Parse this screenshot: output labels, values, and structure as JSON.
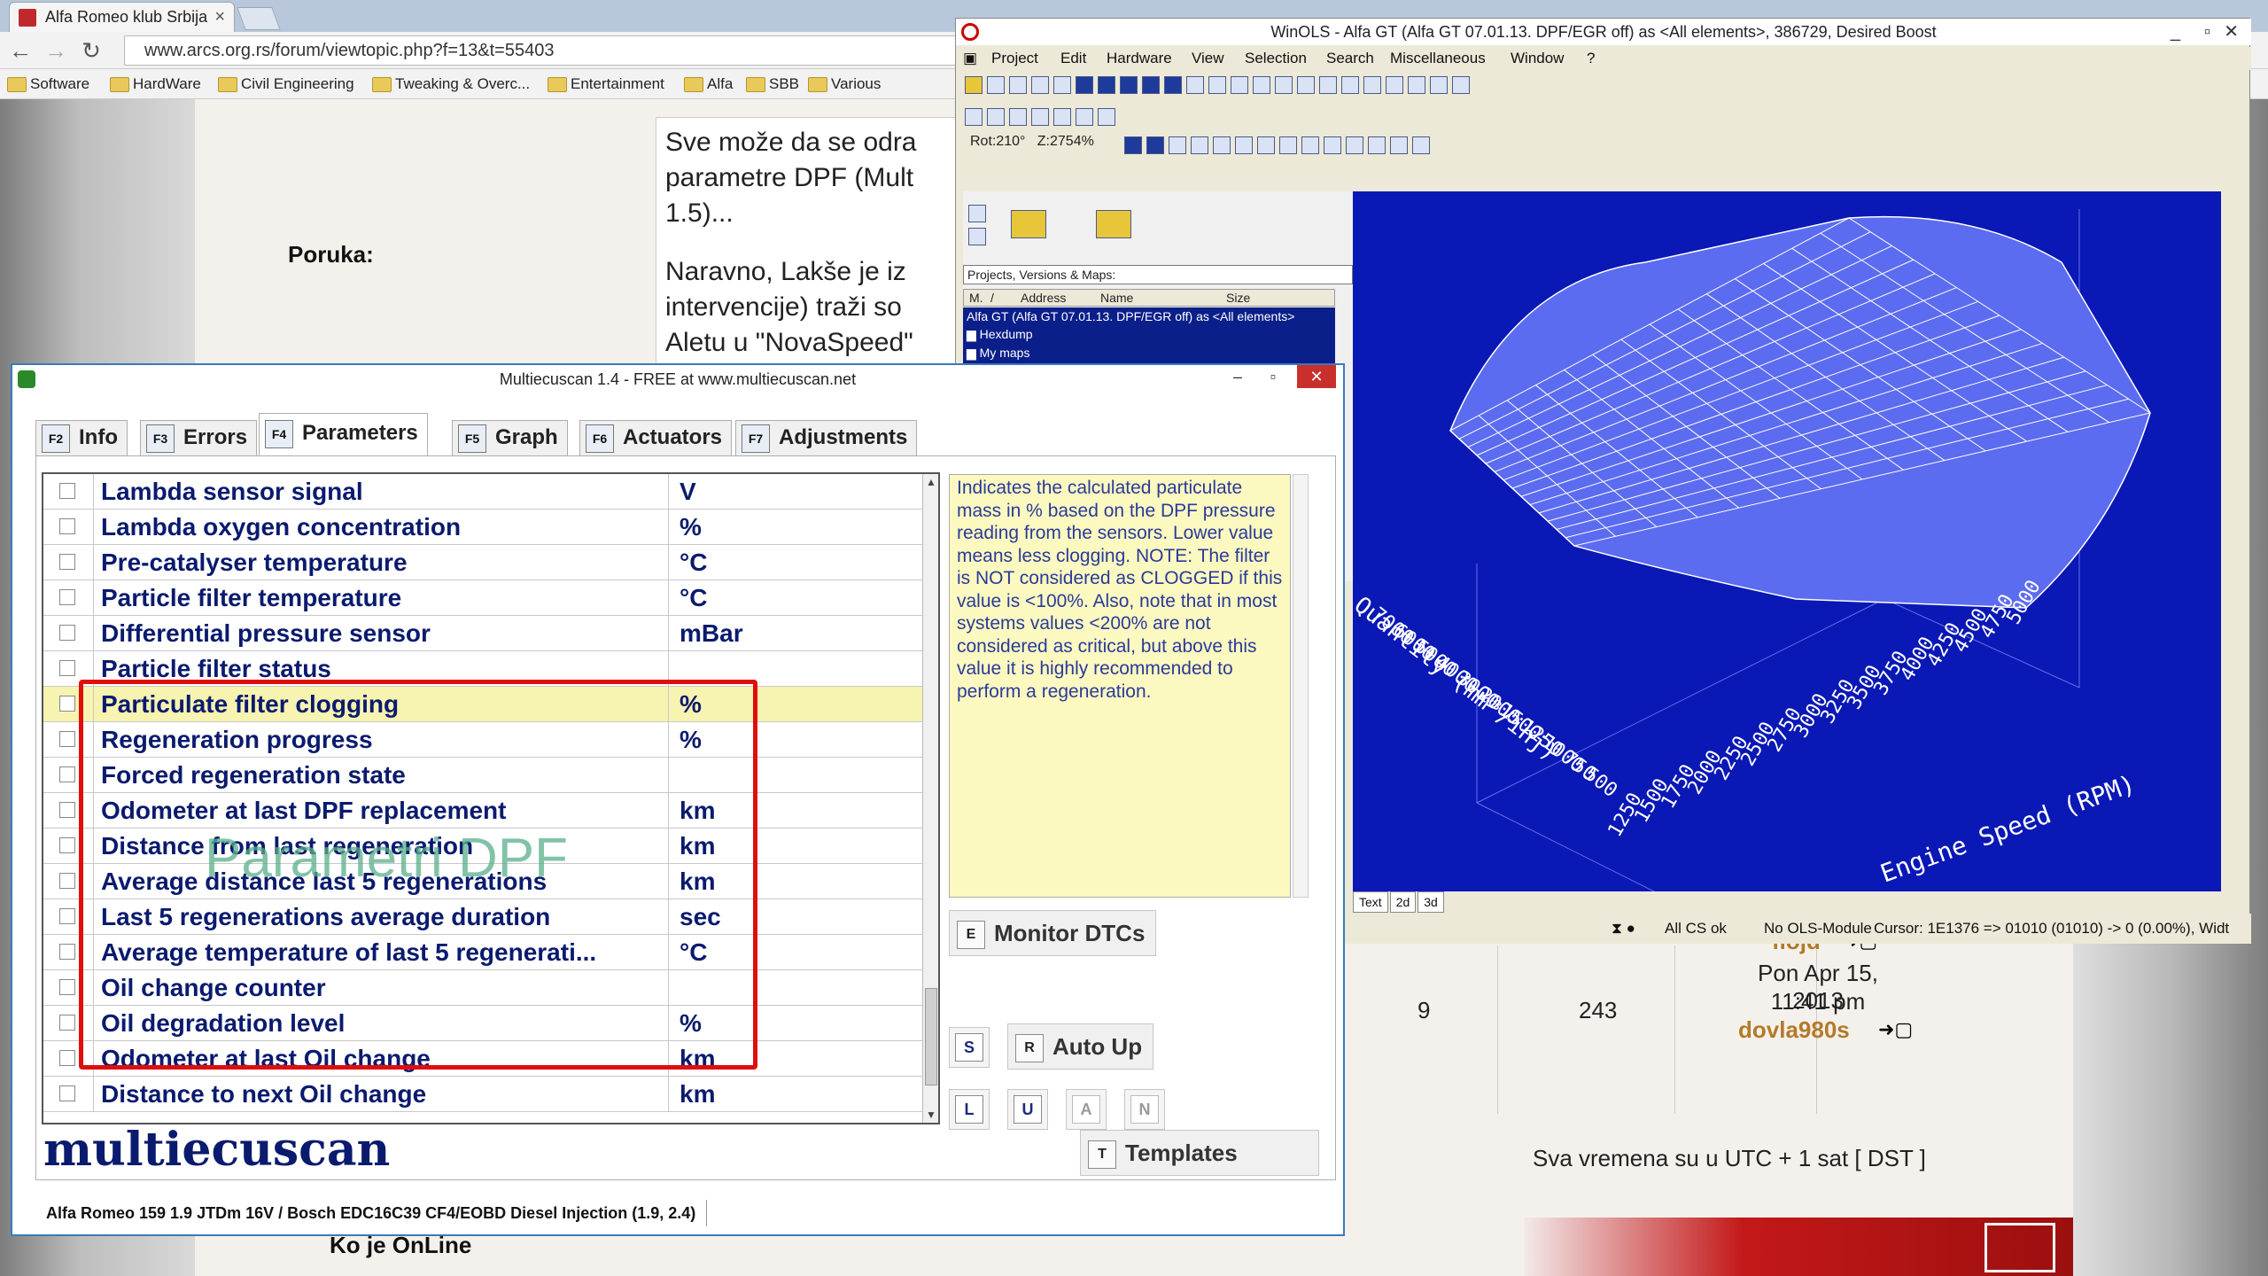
{
  "browser": {
    "tab_title": "Alfa Romeo klub Srbija",
    "url": "www.arcs.org.rs/forum/viewtopic.php?f=13&t=55403",
    "bookmarks": [
      "Software",
      "HardWare",
      "Civil Engineering",
      "Tweaking & Overc...",
      "Entertainment",
      "Alfa",
      "SBB",
      "Various"
    ]
  },
  "forum": {
    "message_label": "Poruka:",
    "message_lines": [
      "Sve može da se odra",
      "parametre DPF (Mult",
      "1.5)..."
    ],
    "message_lines2": [
      "Naravno, Lakše je iz",
      "intervencije) traži so",
      "Aletu u \"NovaSpeed\""
    ],
    "stats": {
      "col1": "9",
      "col2": "243",
      "date": "Pon Apr 15, 2013",
      "time": "11:41 pm",
      "user1": "flojd",
      "user2": "dovla980s"
    },
    "timezone_note": "Sva vremena su u UTC + 1 sat [ DST ]",
    "online_title": "Ko je OnLine"
  },
  "winols": {
    "title": "WinOLS - Alfa GT (Alfa GT 07.01.13. DPF/EGR off) as <All elements>, 386729, Desired Boost",
    "menu": [
      "Project",
      "Edit",
      "Hardware",
      "View",
      "Selection",
      "Search",
      "Miscellaneous",
      "Window",
      "?"
    ],
    "rotation": "Rot:210°",
    "zoom": "Z:2754%",
    "projects_label": "Projects, Versions & Maps:",
    "columns": [
      "M.",
      "/",
      "Address",
      "Name",
      "Size"
    ],
    "project_row": "Alfa GT (Alfa GT 07.01.13. DPF/EGR off) as <All elements>",
    "folders": [
      "Hexdump",
      "My maps"
    ],
    "axis_y_label": "Quantity (mm³/inj)",
    "axis_x_label": "Engine Speed (RPM)",
    "y_ticks": [
      "7000",
      "6000",
      "5000",
      "4000",
      "3000",
      "2000",
      "1500",
      "1250",
      "1000",
      "750",
      "500"
    ],
    "x_ticks": [
      "1250",
      "1500",
      "1750",
      "2000",
      "2250",
      "2500",
      "2750",
      "3000",
      "3250",
      "3500",
      "3750",
      "4000",
      "4250",
      "4500",
      "4750",
      "5000"
    ],
    "view_tabs": [
      "Text",
      "2d",
      "3d"
    ],
    "status": {
      "cs": "All CS ok",
      "module": "No OLS-Module",
      "cursor": "Cursor: 1E1376 => 01010 (01010) -> 0 (0.00%), Widt"
    }
  },
  "mes": {
    "title": "Multiecuscan 1.4 - FREE at www.multiecuscan.net",
    "tabs": [
      {
        "key": "F2",
        "label": "Info"
      },
      {
        "key": "F3",
        "label": "Errors"
      },
      {
        "key": "F4",
        "label": "Parameters"
      },
      {
        "key": "F5",
        "label": "Graph"
      },
      {
        "key": "F6",
        "label": "Actuators"
      },
      {
        "key": "F7",
        "label": "Adjustments"
      }
    ],
    "parameters": [
      {
        "name": "Lambda sensor signal",
        "unit": "V"
      },
      {
        "name": "Lambda oxygen concentration",
        "unit": "%"
      },
      {
        "name": "Pre-catalyser temperature",
        "unit": "°C"
      },
      {
        "name": "Particle filter temperature",
        "unit": "°C"
      },
      {
        "name": "Differential pressure sensor",
        "unit": "mBar"
      },
      {
        "name": "Particle filter status",
        "unit": ""
      },
      {
        "name": "Particulate filter clogging",
        "unit": "%"
      },
      {
        "name": "Regeneration progress",
        "unit": "%"
      },
      {
        "name": "Forced regeneration state",
        "unit": ""
      },
      {
        "name": "Odometer at last DPF replacement",
        "unit": "km"
      },
      {
        "name": "Distance from last regeneration",
        "unit": "km"
      },
      {
        "name": "Average distance last 5 regenerations",
        "unit": "km"
      },
      {
        "name": "Last 5 regenerations average duration",
        "unit": "sec"
      },
      {
        "name": "Average temperature of last 5 regenerati...",
        "unit": "°C"
      },
      {
        "name": "Oil change counter",
        "unit": ""
      },
      {
        "name": "Oil degradation level",
        "unit": "%"
      },
      {
        "name": "Odometer at last Oil change",
        "unit": "km"
      },
      {
        "name": "Distance to next Oil change",
        "unit": "km"
      }
    ],
    "selected_index": 6,
    "watermark": "Parametri DPF",
    "description": "Indicates the calculated particulate mass in % based on the DPF pressure reading from the sensors. Lower value means less clogging. NOTE: The filter is NOT considered as CLOGGED if this value is <100%. Also, note that in most systems values <200% are not considered as critical, but above this value it is highly recommended to perform a regeneration.",
    "buttons": {
      "monitor_key": "E",
      "monitor": "Monitor DTCs",
      "s_key": "S",
      "autoup_key": "R",
      "autoup": "Auto Up",
      "l_key": "L",
      "u_key": "U",
      "a_key": "A",
      "n_key": "N",
      "templates_key": "T",
      "templates": "Templates"
    },
    "brand": "multiecuscan",
    "status_vehicle": "Alfa Romeo 159 1.9 JTDm 16V / Bosch EDC16C39 CF4/EOBD Diesel Injection (1.9, 2.4)"
  }
}
